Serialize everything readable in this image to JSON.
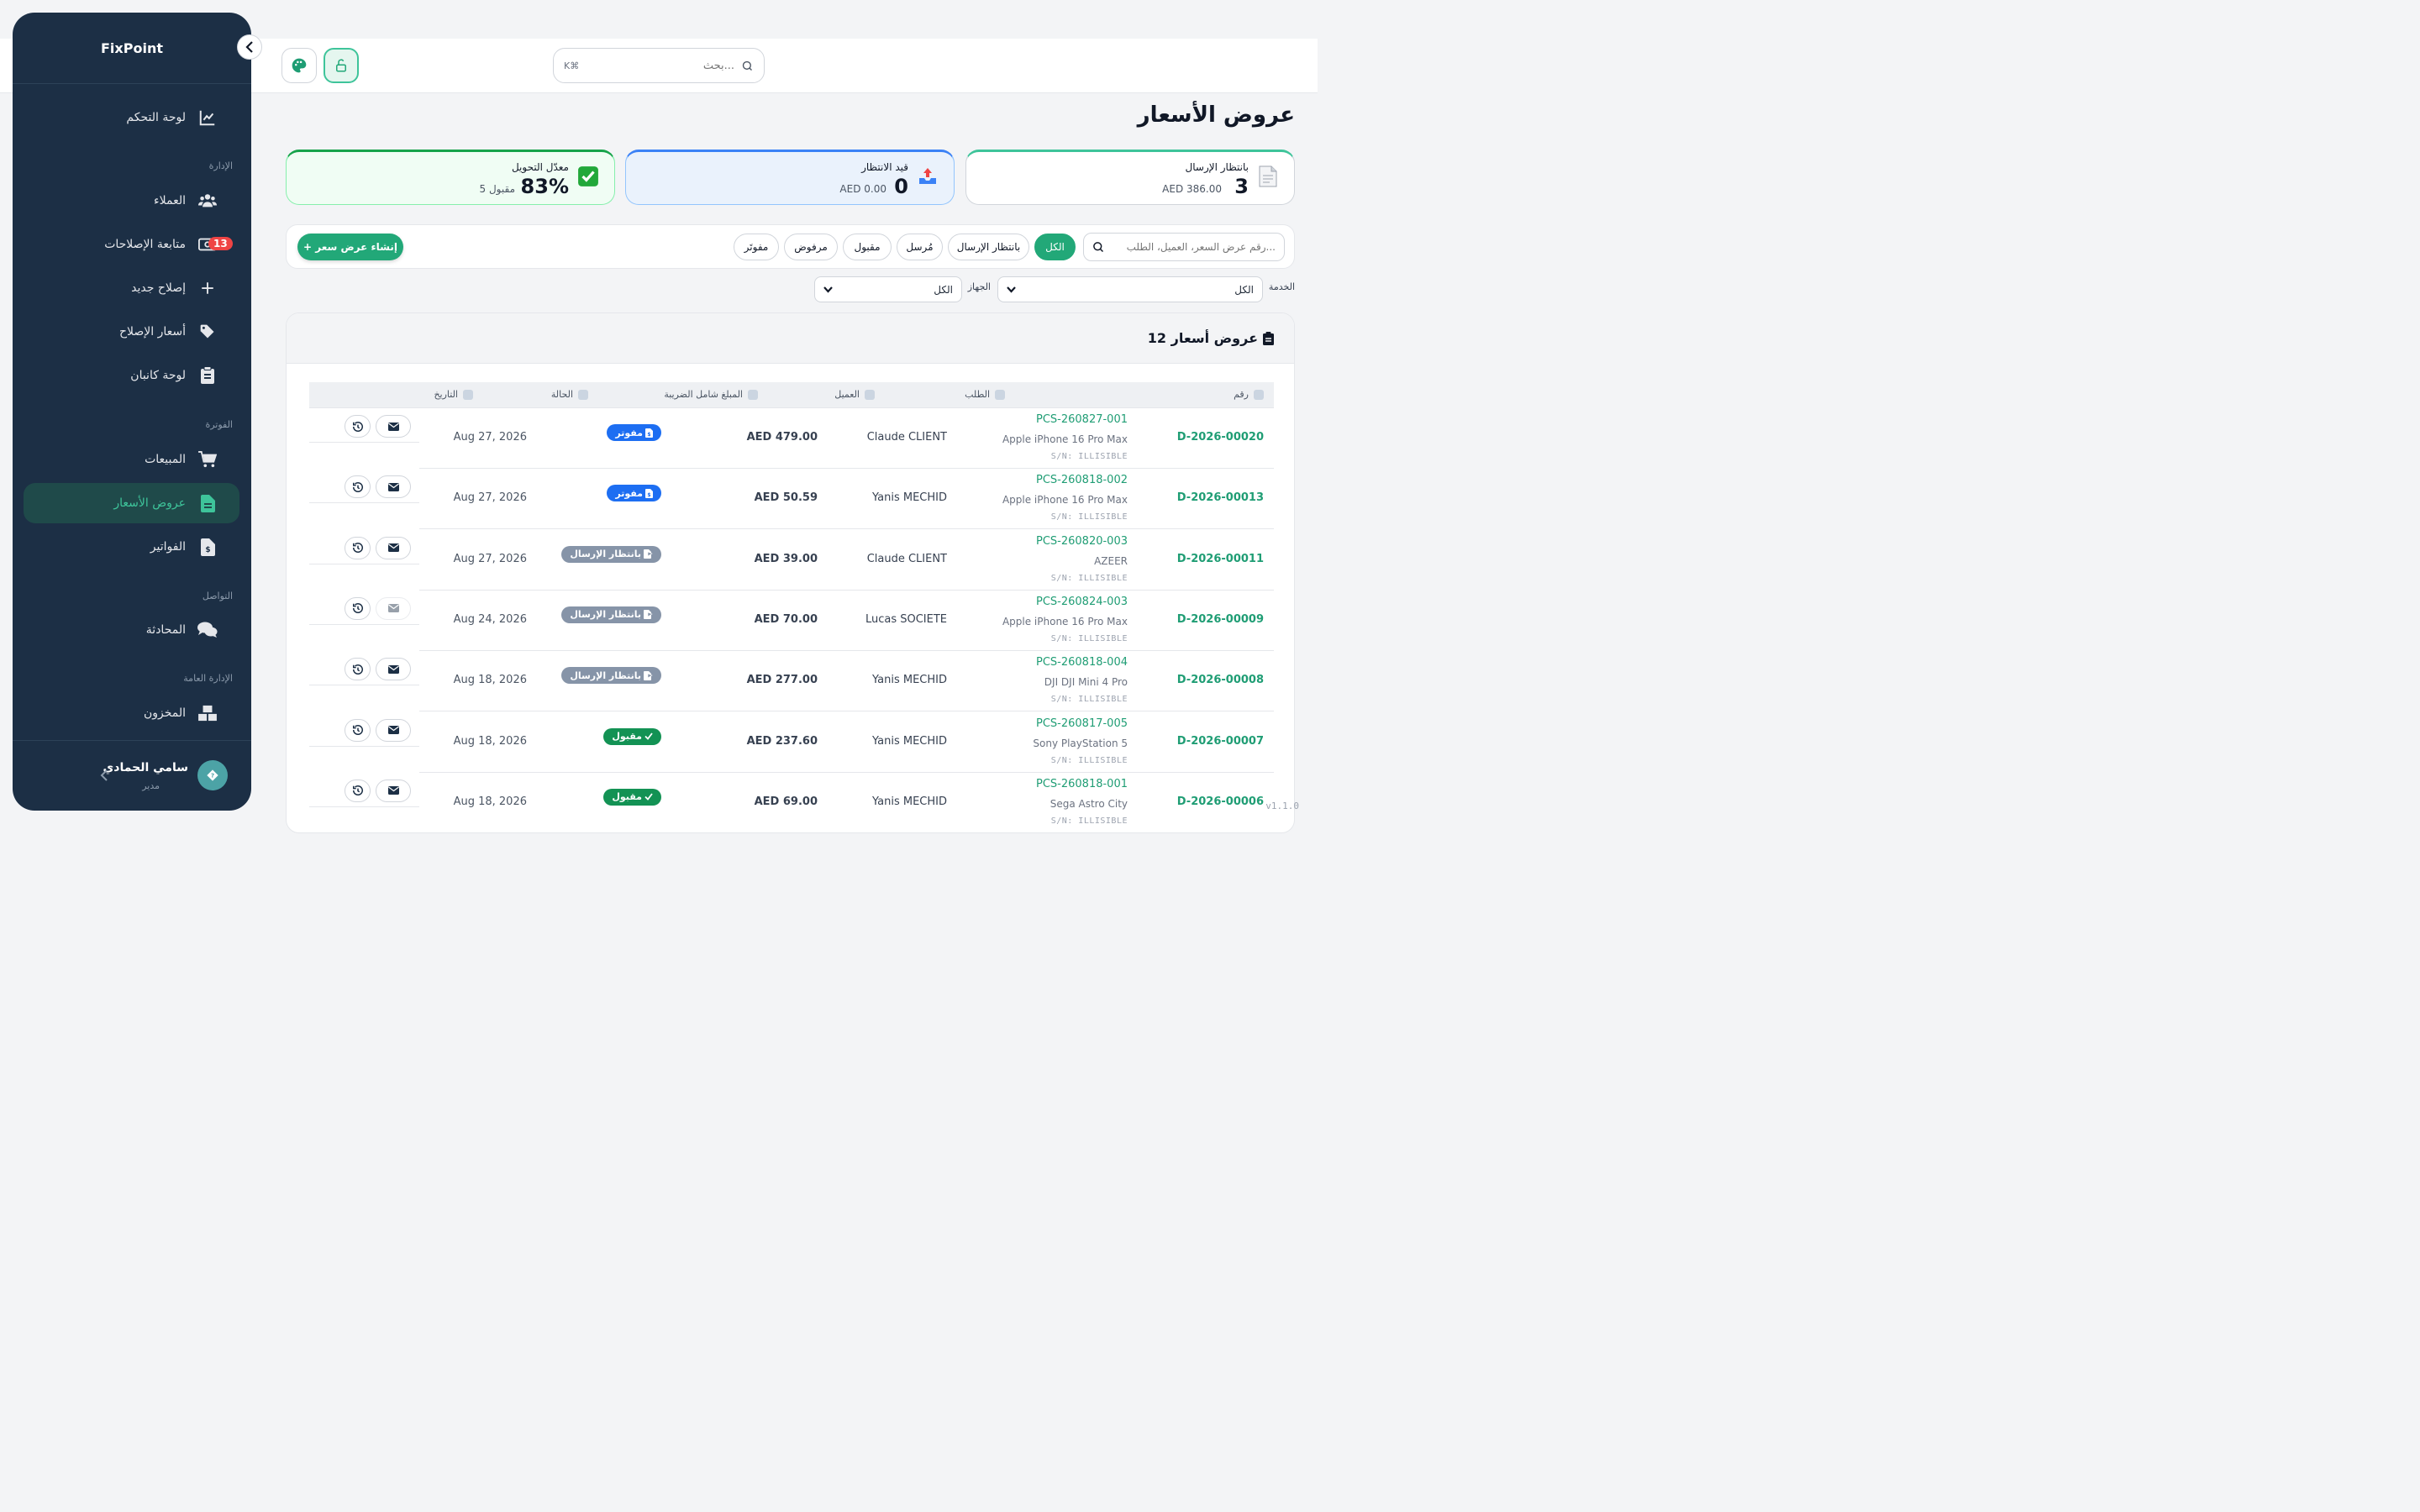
{
  "app": {
    "brand": "FixPoint",
    "version": "v1.1.0"
  },
  "sidebar": {
    "dashboard": "لوحة التحكم",
    "sections": {
      "management": "الإدارة",
      "billing": "الفوترة",
      "communication": "التواصل",
      "general_admin": "الإدارة العامة"
    },
    "items": {
      "customers": "العملاء",
      "repair_tracking": "متابعة الإصلاحات",
      "repair_tracking_badge": "13",
      "new_repair": "إصلاح جديد",
      "repair_prices": "أسعار الإصلاح",
      "kanban": "لوحة كانبان",
      "sales": "المبيعات",
      "quotes": "عروض الأسعار",
      "invoices": "الفواتير",
      "chat": "المحادثة",
      "inventory": "المخزون"
    },
    "user": {
      "name": "سامي الحمادي",
      "role": "مدير"
    }
  },
  "topbar": {
    "search_placeholder": "بحث...",
    "shortcut": "K⌘"
  },
  "page": {
    "title": "عروض الأسعار"
  },
  "stats": {
    "pending_send": {
      "label": "بانتظار الإرسال",
      "value": "3",
      "sub": "AED 386.00"
    },
    "pending": {
      "label": "قيد الانتظار",
      "value": "0",
      "sub": "AED 0.00"
    },
    "conversion": {
      "label": "معدّل التحويل",
      "value": "83%",
      "sub": "5 مقبول"
    }
  },
  "filters": {
    "search_placeholder": "رقم عرض السعر، العميل، الطلب...",
    "chips": [
      "الكل",
      "بانتظار الإرسال",
      "مُرسل",
      "مقبول",
      "مرفوض",
      "مفوتَر"
    ],
    "create_button": "+ إنشاء عرض سعر",
    "service_label": "الخدمة",
    "service_value": "الكل",
    "device_label": "الجهاز",
    "device_value": "الكل"
  },
  "table": {
    "title": "12 عروض أسعار",
    "columns": {
      "number": "رقم",
      "order": "الطلب",
      "client": "العميل",
      "amount": "المبلغ شامل الضريبة",
      "status": "الحالة",
      "date": "التاريخ"
    },
    "rows": [
      {
        "number": "D-2026-00020",
        "order": "PCS-260827-001",
        "device": "Apple iPhone 16 Pro Max",
        "sn": "S/N: ILLISIBLE",
        "client": "Claude CLIENT",
        "amount": "AED 479.00",
        "status": "مفوتر",
        "status_color": "blue",
        "date": "Aug 27, 2026",
        "email_enabled": true
      },
      {
        "number": "D-2026-00013",
        "order": "PCS-260818-002",
        "device": "Apple iPhone 16 Pro Max",
        "sn": "S/N: ILLISIBLE",
        "client": "Yanis MECHID",
        "amount": "AED 50.59",
        "status": "مفوتر",
        "status_color": "blue",
        "date": "Aug 27, 2026",
        "email_enabled": true
      },
      {
        "number": "D-2026-00011",
        "order": "PCS-260820-003",
        "device": "AZEER",
        "sn": "S/N: ILLISIBLE",
        "client": "Claude CLIENT",
        "amount": "AED 39.00",
        "status": "بانتظار الإرسال",
        "status_color": "gray",
        "date": "Aug 27, 2026",
        "email_enabled": true
      },
      {
        "number": "D-2026-00009",
        "order": "PCS-260824-003",
        "device": "Apple iPhone 16 Pro Max",
        "sn": "S/N: ILLISIBLE",
        "client": "Lucas SOCIETE",
        "amount": "AED 70.00",
        "status": "بانتظار الإرسال",
        "status_color": "gray",
        "date": "Aug 24, 2026",
        "email_enabled": false
      },
      {
        "number": "D-2026-00008",
        "order": "PCS-260818-004",
        "device": "DJI DJI Mini 4 Pro",
        "sn": "S/N: ILLISIBLE",
        "client": "Yanis MECHID",
        "amount": "AED 277.00",
        "status": "بانتظار الإرسال",
        "status_color": "gray",
        "date": "Aug 18, 2026",
        "email_enabled": true
      },
      {
        "number": "D-2026-00007",
        "order": "PCS-260817-005",
        "device": "Sony PlayStation 5",
        "sn": "S/N: ILLISIBLE",
        "client": "Yanis MECHID",
        "amount": "AED 237.60",
        "status": "مقبول",
        "status_color": "green",
        "date": "Aug 18, 2026",
        "email_enabled": true
      },
      {
        "number": "D-2026-00006",
        "order": "PCS-260818-001",
        "device": "Sega Astro City",
        "sn": "S/N: ILLISIBLE",
        "client": "Yanis MECHID",
        "amount": "AED 69.00",
        "status": "مقبول",
        "status_color": "green",
        "date": "Aug 18, 2026",
        "email_enabled": true
      }
    ]
  },
  "colors": {
    "sidebar_bg": "#1c2f45",
    "accent": "#22a878",
    "invoiced": "#1d6ef2",
    "pending": "#8694a8",
    "accepted": "#139254"
  }
}
